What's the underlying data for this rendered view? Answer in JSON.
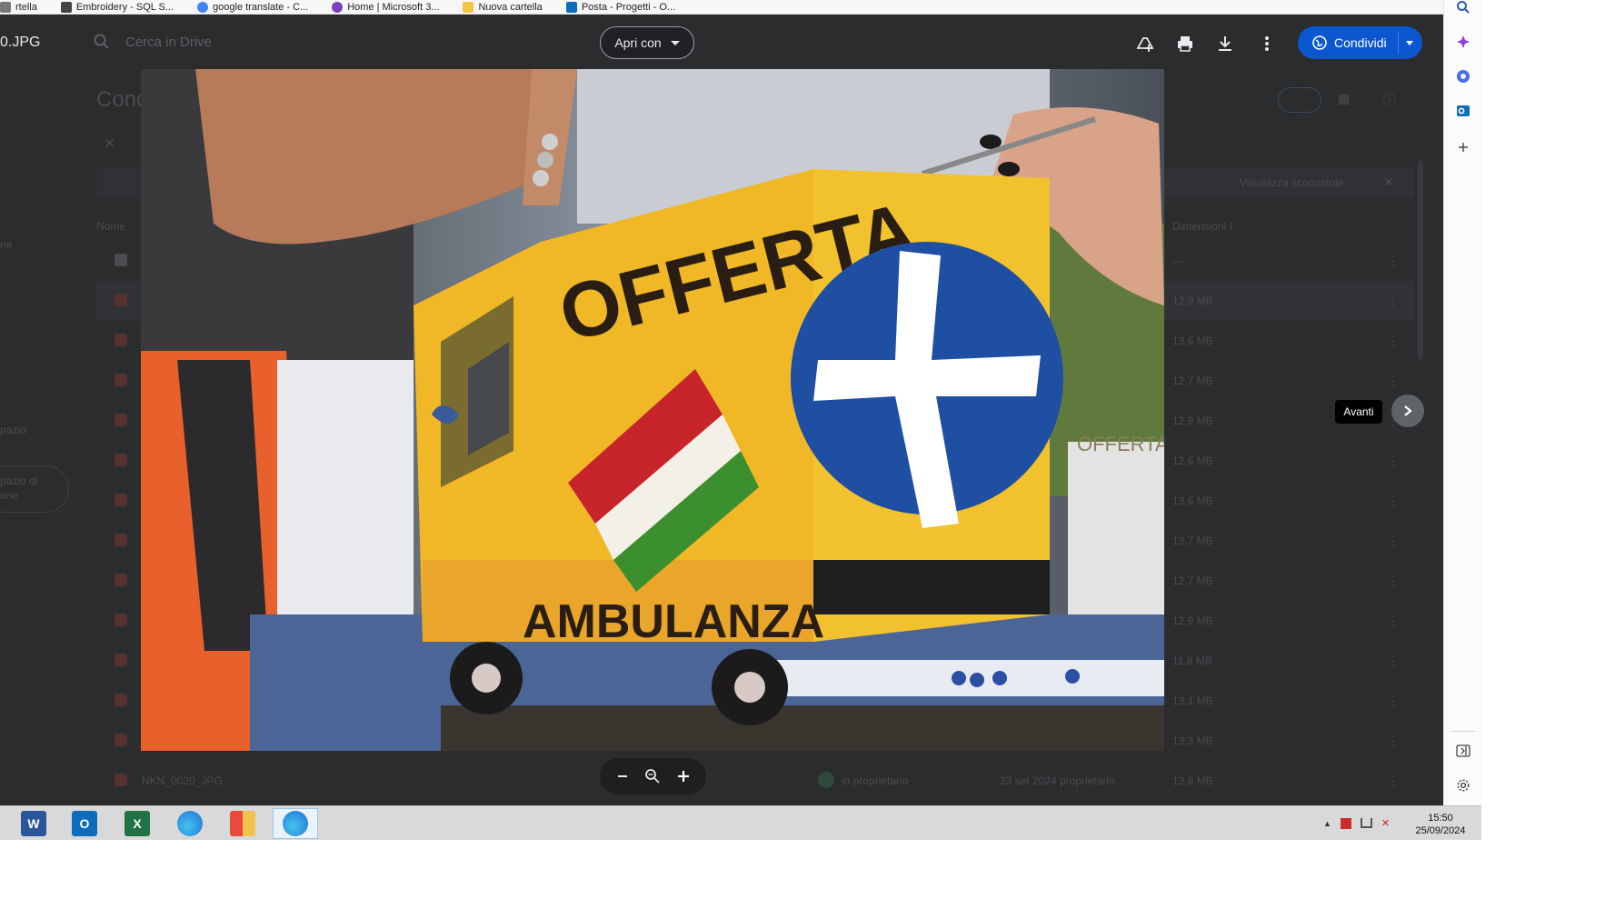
{
  "bookmarks": [
    {
      "label": "rtella",
      "color": "#777777"
    },
    {
      "label": "Embroidery - SQL S...",
      "color": "#444444"
    },
    {
      "label": "google translate - C...",
      "color": "#4285f4"
    },
    {
      "label": "Home | Microsoft 3...",
      "color": "#7b3fbf"
    },
    {
      "label": "Nuova cartella",
      "color": "#f4c542"
    },
    {
      "label": "Posta - Progetti - O...",
      "color": "#0f6cbd"
    }
  ],
  "viewer": {
    "filename": "0.JPG",
    "search_placeholder": "Cerca in Drive",
    "open_with_label": "Apri con",
    "share_label": "Condividi",
    "next_tooltip": "Avanti"
  },
  "background": {
    "folder_title": "Cond",
    "col_name": "Nome",
    "col_size": "Dimensioni f",
    "banner_text": "Visualizza scorciatoie",
    "left_nav": [
      "ne",
      "pazio",
      "pazio di",
      "one"
    ],
    "rows": [
      {
        "size": "—"
      },
      {
        "size": "12,9 MB"
      },
      {
        "size": "13,6 MB"
      },
      {
        "size": "12,7 MB"
      },
      {
        "size": "12,9 MB"
      },
      {
        "size": "12,6 MB"
      },
      {
        "size": "13,6 MB"
      },
      {
        "size": "13,7 MB"
      },
      {
        "size": "12,7 MB"
      },
      {
        "size": "12,9 MB"
      },
      {
        "size": "11,8 MB"
      },
      {
        "size": "13,1 MB"
      },
      {
        "size": "13,3 MB"
      },
      {
        "size": "13,8 MB"
      }
    ],
    "last_row_name": "NKN_0020_JPG",
    "last_row_owner": "io proprietario",
    "last_row_date": "23 set 2024 proprietario"
  },
  "photo": {
    "sign_offerta": "OFFERTA",
    "sign_ambulanza": "AMBULANZA",
    "side_note": "OFFERTA LIBER",
    "colors": {
      "truck": "#f2c12e",
      "circle": "#1f4fa3",
      "flag_green": "#3b8f2e",
      "flag_red": "#c8242b"
    }
  },
  "taskbar": {
    "apps": [
      {
        "name": "word",
        "letter": "W",
        "color": "#2b579a"
      },
      {
        "name": "outlook",
        "letter": "O",
        "color": "#0f6cbd"
      },
      {
        "name": "excel",
        "letter": "X",
        "color": "#217346"
      },
      {
        "name": "edge",
        "letter": "",
        "color": "#1f8fd1"
      },
      {
        "name": "explorer",
        "letter": "",
        "color": "#f3c24d"
      },
      {
        "name": "edge-active",
        "letter": "",
        "color": "#1f8fd1"
      }
    ],
    "time": "15:50",
    "date": "25/09/2024"
  }
}
